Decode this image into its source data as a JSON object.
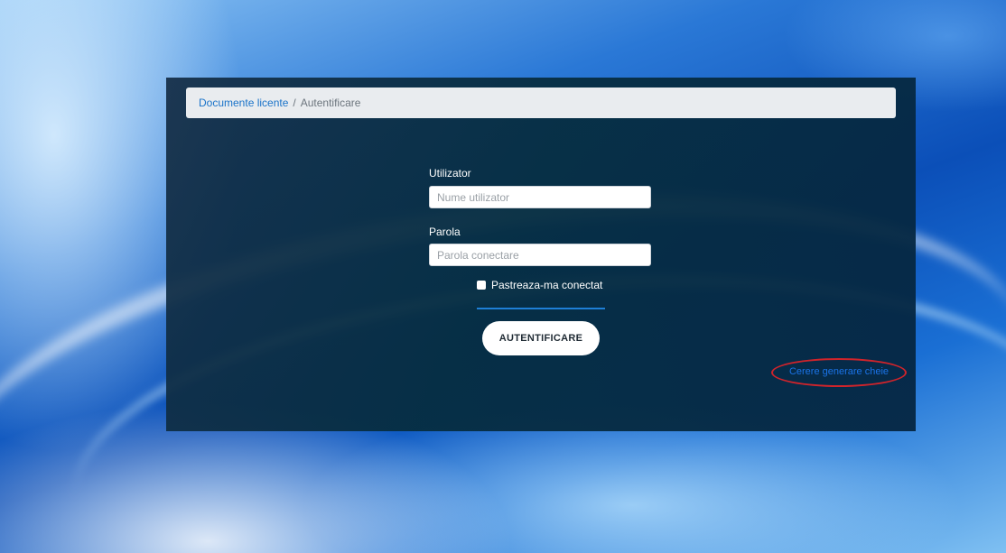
{
  "breadcrumb": {
    "home_label": "Documente licente",
    "separator": "/",
    "current_label": "Autentificare"
  },
  "form": {
    "username_label": "Utilizator",
    "username_placeholder": "Nume utilizator",
    "password_label": "Parola",
    "password_placeholder": "Parola conectare",
    "remember_label": "Pastreaza-ma conectat",
    "submit_label": "AUTENTIFICARE"
  },
  "key_request": {
    "label": "Cerere generare cheie"
  },
  "colors": {
    "link": "#1a73e8",
    "accent_line": "#1e7fd6",
    "annotation": "#d0242b",
    "panel": "#062d40"
  },
  "icons": {
    "remember_checkbox": "checkbox-unchecked-icon"
  }
}
